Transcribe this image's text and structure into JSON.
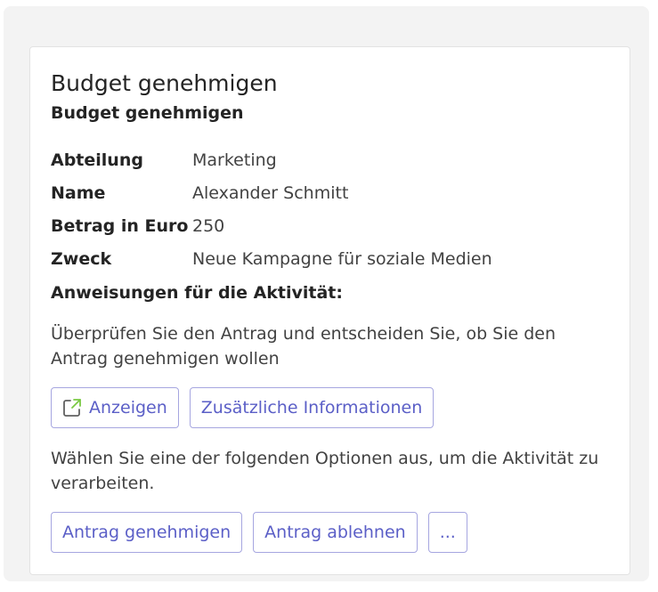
{
  "card": {
    "title": "Budget genehmigen",
    "subtitle": "Budget genehmigen",
    "facts": [
      {
        "label": "Abteilung",
        "value": "Marketing"
      },
      {
        "label": "Name",
        "value": "Alexander Schmitt"
      },
      {
        "label": "Betrag in Euro",
        "value": "250"
      },
      {
        "label": "Zweck",
        "value": "Neue Kampagne für soziale Medien"
      }
    ],
    "instructions_heading": "Anweisungen für die Aktivität:",
    "instructions_text": "Überprüfen Sie den Antrag und entscheiden Sie, ob Sie den Antrag genehmigen wollen",
    "view_button": {
      "label": "Anzeigen",
      "icon": "open-external-icon"
    },
    "info_button": {
      "label": "Zusätzliche Informationen"
    },
    "options_text": "Wählen Sie eine der folgenden Optionen aus, um die Aktivität zu verarbeiten.",
    "approve_button": {
      "label": "Antrag genehmigen"
    },
    "reject_button": {
      "label": "Antrag ablehnen"
    },
    "more_button": {
      "label": "..."
    }
  },
  "colors": {
    "accent": "#5b5fc7",
    "button_border": "#a6a6e0",
    "icon_accent": "#7ac943",
    "background": "#f3f3f3"
  }
}
